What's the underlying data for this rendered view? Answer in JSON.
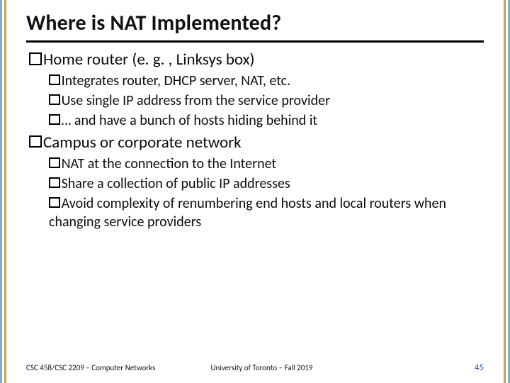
{
  "title": "Where is NAT Implemented?",
  "bullets": {
    "b1": "Home router (e. g. , Linksys box)",
    "b1a": "Integrates router, DHCP server, NAT, etc.",
    "b1b": "Use single IP address from the service provider",
    "b1c": "… and have a bunch of hosts hiding behind it",
    "b2": "Campus or corporate network",
    "b2a": "NAT at the connection to the Internet",
    "b2b": "Share a collection of public IP addresses",
    "b2c": "Avoid complexity of renumbering end hosts and local routers when changing service providers"
  },
  "footer": {
    "left": "CSC 458/CSC 2209 – Computer Networks",
    "center": "University of Toronto – Fall 2019",
    "page": "45"
  }
}
